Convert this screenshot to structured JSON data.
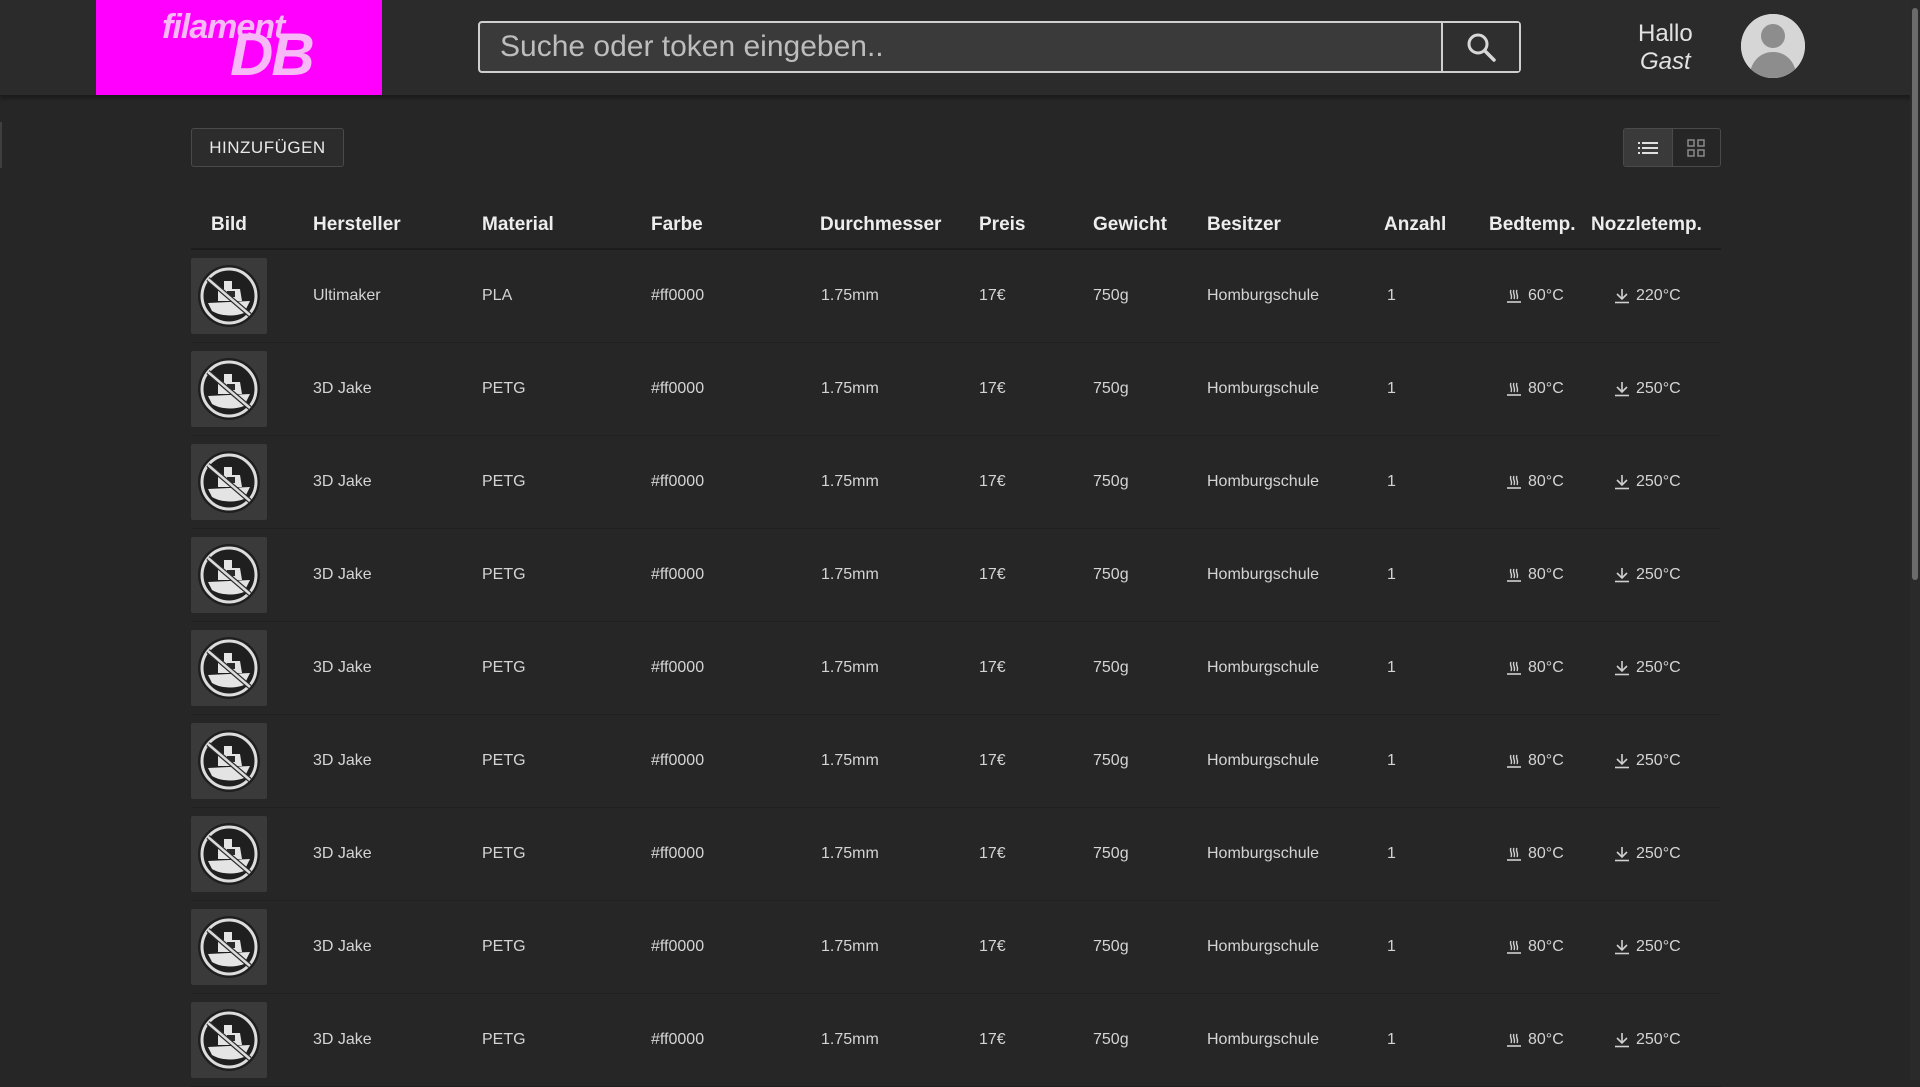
{
  "logo": {
    "top": "filament",
    "bottom": "DB"
  },
  "search": {
    "placeholder": "Suche oder token eingeben.."
  },
  "user": {
    "greeting": "Hallo",
    "name": "Gast"
  },
  "toolbar": {
    "add_label": "HINZUFÜGEN"
  },
  "table": {
    "headers": [
      "Bild",
      "Hersteller",
      "Material",
      "Farbe",
      "Durchmesser",
      "Preis",
      "Gewicht",
      "Besitzer",
      "Anzahl",
      "Bedtemp.",
      "Nozzletemp."
    ],
    "rows": [
      {
        "hersteller": "Ultimaker",
        "material": "PLA",
        "farbe": "#ff0000",
        "durchmesser": "1.75mm",
        "preis": "17€",
        "gewicht": "750g",
        "besitzer": "Homburgschule",
        "anzahl": "1",
        "bedtemp": "60°C",
        "nozzletemp": "220°C"
      },
      {
        "hersteller": "3D Jake",
        "material": "PETG",
        "farbe": "#ff0000",
        "durchmesser": "1.75mm",
        "preis": "17€",
        "gewicht": "750g",
        "besitzer": "Homburgschule",
        "anzahl": "1",
        "bedtemp": "80°C",
        "nozzletemp": "250°C"
      },
      {
        "hersteller": "3D Jake",
        "material": "PETG",
        "farbe": "#ff0000",
        "durchmesser": "1.75mm",
        "preis": "17€",
        "gewicht": "750g",
        "besitzer": "Homburgschule",
        "anzahl": "1",
        "bedtemp": "80°C",
        "nozzletemp": "250°C"
      },
      {
        "hersteller": "3D Jake",
        "material": "PETG",
        "farbe": "#ff0000",
        "durchmesser": "1.75mm",
        "preis": "17€",
        "gewicht": "750g",
        "besitzer": "Homburgschule",
        "anzahl": "1",
        "bedtemp": "80°C",
        "nozzletemp": "250°C"
      },
      {
        "hersteller": "3D Jake",
        "material": "PETG",
        "farbe": "#ff0000",
        "durchmesser": "1.75mm",
        "preis": "17€",
        "gewicht": "750g",
        "besitzer": "Homburgschule",
        "anzahl": "1",
        "bedtemp": "80°C",
        "nozzletemp": "250°C"
      },
      {
        "hersteller": "3D Jake",
        "material": "PETG",
        "farbe": "#ff0000",
        "durchmesser": "1.75mm",
        "preis": "17€",
        "gewicht": "750g",
        "besitzer": "Homburgschule",
        "anzahl": "1",
        "bedtemp": "80°C",
        "nozzletemp": "250°C"
      },
      {
        "hersteller": "3D Jake",
        "material": "PETG",
        "farbe": "#ff0000",
        "durchmesser": "1.75mm",
        "preis": "17€",
        "gewicht": "750g",
        "besitzer": "Homburgschule",
        "anzahl": "1",
        "bedtemp": "80°C",
        "nozzletemp": "250°C"
      },
      {
        "hersteller": "3D Jake",
        "material": "PETG",
        "farbe": "#ff0000",
        "durchmesser": "1.75mm",
        "preis": "17€",
        "gewicht": "750g",
        "besitzer": "Homburgschule",
        "anzahl": "1",
        "bedtemp": "80°C",
        "nozzletemp": "250°C"
      },
      {
        "hersteller": "3D Jake",
        "material": "PETG",
        "farbe": "#ff0000",
        "durchmesser": "1.75mm",
        "preis": "17€",
        "gewicht": "750g",
        "besitzer": "Homburgschule",
        "anzahl": "1",
        "bedtemp": "80°C",
        "nozzletemp": "250°C"
      }
    ]
  },
  "colors": {
    "brand": "#ff00ff",
    "background": "#262626",
    "header": "#2b2b2b"
  },
  "icons": {
    "search": "search-icon",
    "avatar": "avatar-icon",
    "list_view": "list-view-icon",
    "grid_view": "grid-view-icon",
    "bed": "bed-heat-icon",
    "nozzle": "nozzle-icon",
    "thumb": "no-image-boat-icon"
  }
}
